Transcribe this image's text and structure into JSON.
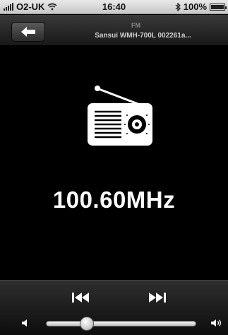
{
  "status_bar": {
    "carrier": "O2-UK",
    "time": "16:40",
    "battery": "100%",
    "battery_level": 1.0
  },
  "nav": {
    "subtitle": "FM",
    "title": "Sansui WMH-700L 002261a..."
  },
  "main": {
    "frequency": "100.60MHz"
  },
  "controls": {
    "volume_level": 0.25
  },
  "icons": {
    "back": "arrow-left-icon",
    "radio": "radio-icon",
    "prev": "skip-back-icon",
    "next": "skip-forward-icon",
    "wifi": "wifi-icon",
    "bluetooth": "bluetooth-icon"
  },
  "colors": {
    "background": "#000000",
    "text": "#ffffff"
  }
}
